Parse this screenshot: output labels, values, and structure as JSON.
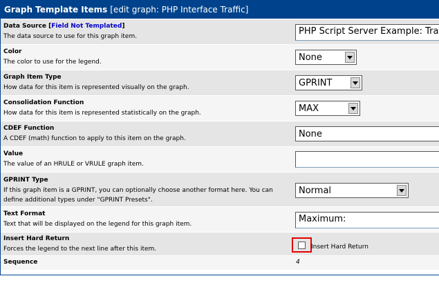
{
  "header": {
    "title": "Graph Template Items",
    "subtitle": "[edit graph: PHP Interface Traffic]"
  },
  "fields": {
    "data_source": {
      "label": "Data Source",
      "link_open": "[",
      "link": "Field Not Templated",
      "link_close": "]",
      "description": "The data source to use for this graph item.",
      "value": "PHP Script Server Example: Traffic"
    },
    "color": {
      "label": "Color",
      "description": "The color to use for the legend.",
      "value": "None"
    },
    "graph_item_type": {
      "label": "Graph Item Type",
      "description": "How data for this item is represented visually on the graph.",
      "value": "GPRINT"
    },
    "consolidation_function": {
      "label": "Consolidation Function",
      "description": "How data for this item is represented statistically on the graph.",
      "value": "MAX"
    },
    "cdef_function": {
      "label": "CDEF Function",
      "description": "A CDEF (math) function to apply to this item on the graph.",
      "value": "None"
    },
    "value": {
      "label": "Value",
      "description": "The value of an HRULE or VRULE graph item.",
      "value": ""
    },
    "gprint_type": {
      "label": "GPRINT Type",
      "description_line1": "If this graph item is a GPRINT, you can optionally choose another format here. You can",
      "description_line2": "define additional types under \"GPRINT Presets\".",
      "value": "Normal"
    },
    "text_format": {
      "label": "Text Format",
      "description": "Text that will be displayed on the legend for this graph item.",
      "value": "Maximum:"
    },
    "insert_hard_return": {
      "label": "Insert Hard Return",
      "description": "Forces the legend to the next line after this item.",
      "checkbox_label": "Insert Hard Return",
      "checked": false
    },
    "sequence": {
      "label": "Sequence",
      "value": "4"
    }
  },
  "colors": {
    "header_bg": "#00438C",
    "row_even": "#E5E5E5",
    "row_odd": "#F5F5F5",
    "link": "#0000C8",
    "highlight": "#E00000"
  }
}
